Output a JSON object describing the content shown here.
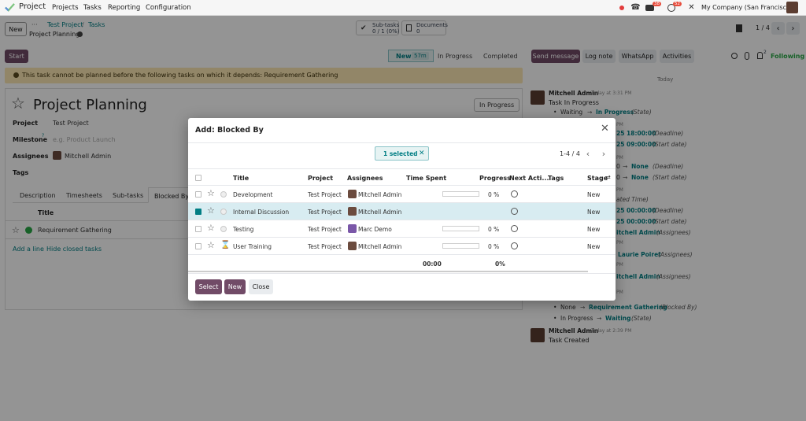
{
  "topnav": {
    "app_name": "Project",
    "menu": [
      "Projects",
      "Tasks",
      "Reporting",
      "Configuration"
    ],
    "company": "My Company (San Francisco)",
    "badge_messages": "38",
    "badge_activities": "52"
  },
  "control": {
    "new_label": "New",
    "breadcrumb_parent": "Test Project",
    "breadcrumb_sep": "/",
    "breadcrumb_tasks": "Tasks",
    "breadcrumb_current": "Project Planning",
    "subtasks_label": "Sub-tasks",
    "subtasks_value": "0 / 1 (0%)",
    "documents_label": "Documents",
    "documents_value": "0",
    "pager": "1 / 4"
  },
  "statusbar": {
    "start_label": "Start",
    "stages": [
      "New",
      "In Progress",
      "Completed"
    ],
    "new_timer": "57m"
  },
  "chatter_buttons": {
    "send_message": "Send message",
    "log_note": "Log note",
    "whatsapp": "WhatsApp",
    "activities": "Activities",
    "followers_count": "2",
    "following": "Following"
  },
  "warning": "This task cannot be planned before the following tasks on which it depends: Requirement Gathering",
  "form": {
    "title": "Project Planning",
    "state_badge": "In Progress",
    "project_label": "Project",
    "project_value": "Test Project",
    "milestone_label": "Milestone",
    "milestone_sup": "?",
    "milestone_placeholder": "e.g. Product Launch",
    "assignees_label": "Assignees",
    "assignee_value": "Mitchell Admin",
    "tags_label": "Tags",
    "tabs": [
      "Description",
      "Timesheets",
      "Sub-tasks",
      "Blocked By"
    ],
    "blocked_col_title": "Title",
    "blocked_row": "Requirement Gathering",
    "add_line": "Add a line",
    "hide_closed": "Hide closed tasks"
  },
  "chatter": {
    "day": "Today",
    "author": "Mitchell Admin",
    "time1": "Today at 3:31 PM",
    "subject1": "Task In Progress",
    "c1_from": "Waiting",
    "c1_to": "In Progress",
    "c1_field": "(State)",
    "pm": "PM",
    "v_18": "25 18:00:00",
    "v_09": "25 09:00:00",
    "deadline": "(Deadline)",
    "start_date": "(Start date)",
    "none": "None",
    "arrow": "→",
    "zero": "0",
    "ated_time": "ated Time)",
    "v_00": "25 00:00:00",
    "itchell_admin": "itchell Admin",
    "assignees_f": "(Assignees)",
    "laurie": "Laurie Poiret",
    "c_none": "None",
    "c_req": "Requirement Gathering",
    "c_blocked": "(Blocked By)",
    "c_inprog": "In Progress",
    "c_waiting": "Waiting",
    "c_state": "(State)",
    "time2": "Today at 2:39 PM",
    "created": "Task Created"
  },
  "modal": {
    "title": "Add: Blocked By",
    "selected_label": "1 selected",
    "pager": "1-4 / 4",
    "columns": [
      "Title",
      "Project",
      "Assignees",
      "Time Spent",
      "Progress",
      "Next Acti...",
      "Tags",
      "Stage"
    ],
    "rows": [
      {
        "title": "Development",
        "project": "Test Project",
        "assignee": "Mitchell Admin",
        "progress_text": "0 %",
        "progress": 0,
        "stage": "New",
        "checked": false,
        "selected": false,
        "icon": "circle"
      },
      {
        "title": "Internal Discussion",
        "project": "Test Project",
        "assignee": "Mitchell Admin",
        "progress_text": "",
        "progress": 0,
        "stage": "New",
        "checked": true,
        "selected": true,
        "icon": "circle"
      },
      {
        "title": "Testing",
        "project": "Test Project",
        "assignee": "Marc Demo",
        "progress_text": "0 %",
        "progress": 0,
        "stage": "New",
        "checked": false,
        "selected": false,
        "icon": "circle"
      },
      {
        "title": "User Training",
        "project": "Test Project",
        "assignee": "Mitchell Admin",
        "progress_text": "0 %",
        "progress": 0,
        "stage": "New",
        "checked": false,
        "selected": false,
        "icon": "hourglass"
      }
    ],
    "total_time": "00:00",
    "total_progress": "0%",
    "select_label": "Select",
    "new_label": "New",
    "close_label": "Close"
  },
  "colors": {
    "brand_purple": "#714b67",
    "accent_teal": "#017e84",
    "warning_bg": "#fbe7b4",
    "success_green": "#28a745"
  }
}
